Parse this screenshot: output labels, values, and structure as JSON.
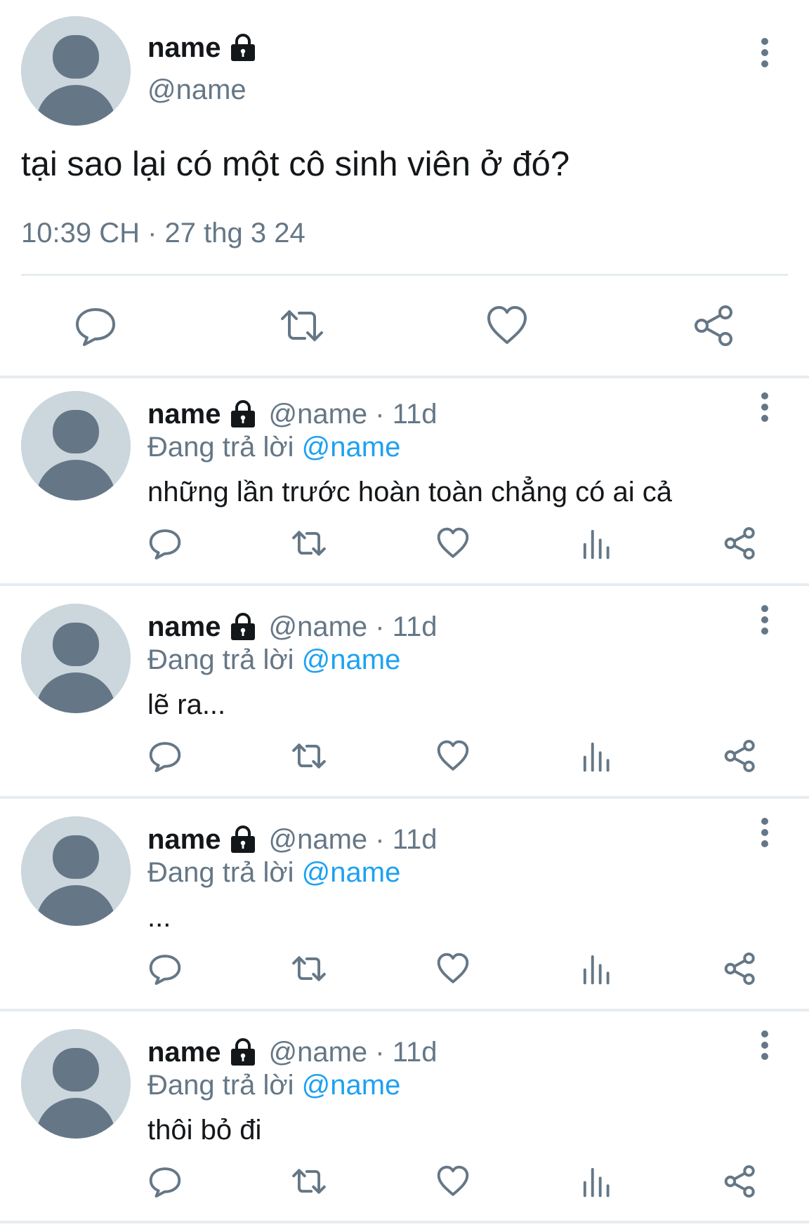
{
  "main_tweet": {
    "name": "name",
    "handle": "@name",
    "text": "tại sao lại có một cô sinh viên ở đó?",
    "meta": "10:39 CH · 27 thg 3 24",
    "actions": [
      "reply-icon",
      "retweet-icon",
      "like-icon",
      "share-icon"
    ]
  },
  "replies": [
    {
      "name": "name",
      "handle_time": "@name · 11d",
      "replying_prefix": "Đang trả lời",
      "replying_to": "@name",
      "text": "những lần trước hoàn toàn chẳng có ai cả"
    },
    {
      "name": "name",
      "handle_time": "@name · 11d",
      "replying_prefix": "Đang trả lời",
      "replying_to": "@name",
      "text": "lẽ ra..."
    },
    {
      "name": "name",
      "handle_time": "@name · 11d",
      "replying_prefix": "Đang trả lời",
      "replying_to": "@name",
      "text": "..."
    },
    {
      "name": "name",
      "handle_time": "@name · 11d",
      "replying_prefix": "Đang trả lời",
      "replying_to": "@name",
      "text": "thôi bỏ đi"
    }
  ],
  "reply_actions": [
    "reply-icon",
    "retweet-icon",
    "like-icon",
    "analytics-icon",
    "share-icon"
  ],
  "colors": {
    "text_primary": "#14171a",
    "text_secondary": "#657786",
    "mention": "#1da1f2",
    "avatar_bg": "#ccd6dd",
    "avatar_fg": "#657786",
    "divider": "#e6ecf0"
  }
}
